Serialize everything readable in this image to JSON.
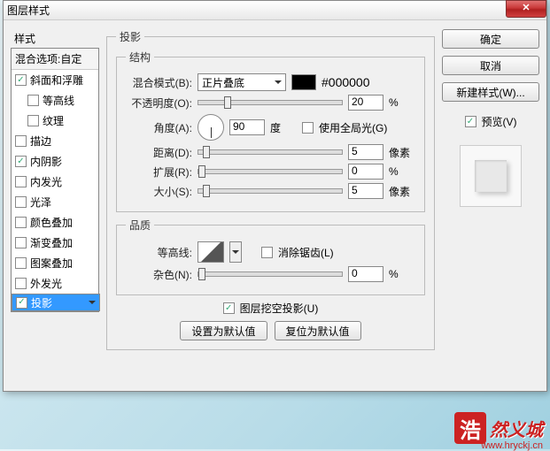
{
  "title": "图层样式",
  "sidebar": {
    "header": "样式",
    "blend_header": "混合选项:自定",
    "items": [
      {
        "label": "斜面和浮雕",
        "checked": true
      },
      {
        "label": "等高线",
        "checked": false,
        "indent": true
      },
      {
        "label": "纹理",
        "checked": false,
        "indent": true
      },
      {
        "label": "描边",
        "checked": false
      },
      {
        "label": "内阴影",
        "checked": true
      },
      {
        "label": "内发光",
        "checked": false
      },
      {
        "label": "光泽",
        "checked": false
      },
      {
        "label": "颜色叠加",
        "checked": false
      },
      {
        "label": "渐变叠加",
        "checked": false
      },
      {
        "label": "图案叠加",
        "checked": false
      },
      {
        "label": "外发光",
        "checked": false
      },
      {
        "label": "投影",
        "checked": true,
        "selected": true
      }
    ]
  },
  "panel": {
    "legend": "投影",
    "structure_legend": "结构",
    "blend_mode_label": "混合模式(B):",
    "blend_mode_value": "正片叠底",
    "color_hex": "#000000",
    "opacity_label": "不透明度(O):",
    "opacity_value": "20",
    "opacity_unit": "%",
    "opacity_pos": "18%",
    "angle_label": "角度(A):",
    "angle_value": "90",
    "angle_unit": "度",
    "global_light_label": "使用全局光(G)",
    "global_light_checked": false,
    "distance_label": "距离(D):",
    "distance_value": "5",
    "distance_unit": "像素",
    "distance_pos": "3%",
    "spread_label": "扩展(R):",
    "spread_value": "0",
    "spread_unit": "%",
    "spread_pos": "0%",
    "size_label": "大小(S):",
    "size_value": "5",
    "size_unit": "像素",
    "size_pos": "3%",
    "quality_legend": "品质",
    "contour_label": "等高线:",
    "antialias_label": "消除锯齿(L)",
    "antialias_checked": false,
    "noise_label": "杂色(N):",
    "noise_value": "0",
    "noise_unit": "%",
    "noise_pos": "0%",
    "knockout_label": "图层挖空投影(U)",
    "knockout_checked": true,
    "make_default": "设置为默认值",
    "reset_default": "复位为默认值"
  },
  "buttons": {
    "ok": "确定",
    "cancel": "取消",
    "new_style": "新建样式(W)...",
    "preview": "预览(V)",
    "preview_checked": true
  },
  "watermark": {
    "char": "浩",
    "text": "然义城",
    "url": "www.hryckj.cn"
  }
}
